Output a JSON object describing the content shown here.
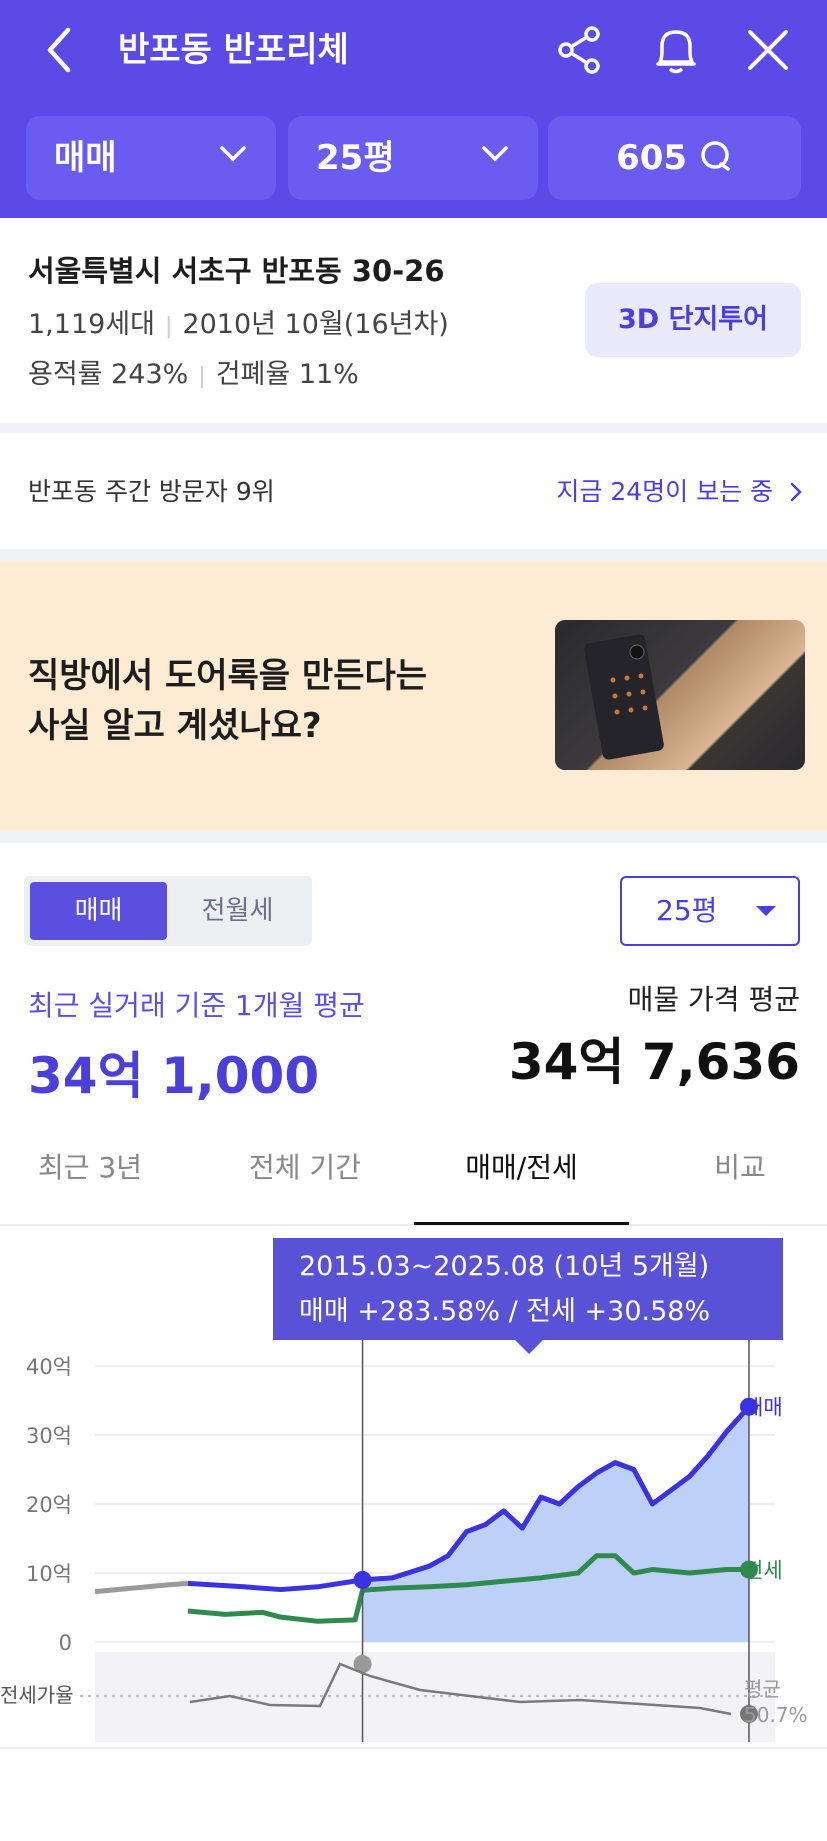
{
  "header": {
    "title": "반포동 반포리체",
    "filters": {
      "deal_type": "매매",
      "size": "25평",
      "comments": "605"
    }
  },
  "complex": {
    "address": "서울특별시 서초구 반포동 30-26",
    "households": "1,119세대",
    "built": "2010년 10월(16년차)",
    "floor_area_ratio": "용적률 243%",
    "coverage_ratio": "건폐율 11%",
    "tour_button": "3D 단지투어"
  },
  "visitors": {
    "rank": "반포동 주간 방문자 9위",
    "now": "지금 24명이 보는 중"
  },
  "banner": {
    "line1": "직방에서 도어록을 만든다는",
    "line2": "사실 알고 계셨나요?"
  },
  "price": {
    "toggle": [
      "매매",
      "전월세"
    ],
    "size_select": "25평",
    "recent_label": "최근 실거래 기준 1개월 평균",
    "recent_value": "34억 1,000",
    "ask_label": "매물 가격 평균",
    "ask_value": "34억 7,636"
  },
  "tabs": [
    "최근 3년",
    "전체 기간",
    "매매/전세",
    "비교"
  ],
  "tooltip": {
    "line1": "2015.03~2025.08 (10년 5개월)",
    "line2": "매매 +283.58%  /  전세 +30.58%"
  },
  "colors": {
    "brand": "#5b4ae5",
    "sale": "#3b32e0",
    "jeonse": "#2f8a4e",
    "ratio": "#7a7a7a"
  },
  "chart_data": {
    "type": "line",
    "ylim": [
      0,
      40
    ],
    "yticks": [
      "40억",
      "30억",
      "20억",
      "10억",
      "0"
    ],
    "xticks": [
      "2010",
      "2012",
      "2014",
      "2016",
      "2018",
      "2020",
      "2022",
      "2024"
    ],
    "ratio_label": "전세가율",
    "ratio_avg_label": "평균",
    "ratio_avg_value": "50.7%",
    "series": [
      {
        "name": "매매",
        "x": [
          2008.0,
          2010.0,
          2010.5,
          2012.0,
          2013.0,
          2014.0,
          2015.2,
          2016.0,
          2017.0,
          2017.5,
          2018.0,
          2018.5,
          2019.0,
          2019.5,
          2020.0,
          2020.5,
          2021.0,
          2021.5,
          2022.0,
          2022.5,
          2023.0,
          2023.5,
          2024.0,
          2024.5,
          2025.0,
          2025.6
        ],
        "values": [
          7.3,
          8.3,
          8.5,
          8.0,
          7.6,
          8.0,
          9.0,
          9.3,
          11.0,
          12.5,
          16.0,
          17.0,
          19.0,
          16.5,
          21.0,
          20.0,
          22.5,
          24.5,
          26.0,
          25.0,
          20.0,
          22.0,
          24.0,
          27.0,
          30.5,
          34.1
        ]
      },
      {
        "name": "전세",
        "x": [
          2010.5,
          2011.5,
          2012.5,
          2013.0,
          2014.0,
          2015.0,
          2015.2,
          2016.0,
          2017.0,
          2018.0,
          2019.0,
          2020.0,
          2021.0,
          2021.5,
          2022.0,
          2022.5,
          2023.0,
          2024.0,
          2025.0,
          2025.6
        ],
        "values": [
          4.5,
          4.0,
          4.3,
          3.6,
          3.0,
          3.2,
          7.5,
          7.8,
          8.0,
          8.3,
          8.8,
          9.3,
          10.0,
          12.5,
          12.5,
          10.0,
          10.5,
          10.0,
          10.5,
          10.5
        ]
      }
    ]
  }
}
